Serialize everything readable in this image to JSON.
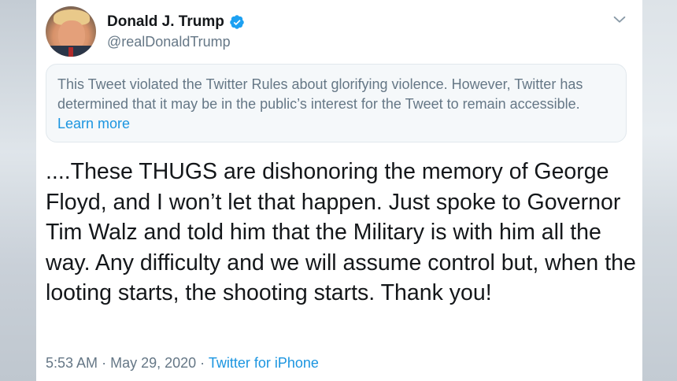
{
  "user": {
    "display_name": "Donald J. Trump",
    "handle": "@realDonaldTrump",
    "verified_icon": "verified-badge-icon"
  },
  "menu": {
    "icon": "chevron-down-icon"
  },
  "notice": {
    "text": "This Tweet violated the Twitter Rules about glorifying violence. However, Twitter has determined that it may be in the public’s interest for the Tweet to remain accessible.",
    "link_label": "Learn more"
  },
  "tweet": {
    "text": "....These THUGS are dishonoring the memory of George Floyd, and I won’t let that happen. Just spoke to Governor Tim Walz and told him that the Military is with him all the way. Any difficulty and we will assume control but, when the looting starts, the shooting starts. Thank you!"
  },
  "meta": {
    "time": "5:53 AM",
    "separator": "·",
    "date": "May 29, 2020",
    "source": "Twitter for iPhone"
  },
  "colors": {
    "link": "#1b95e0",
    "secondary_text": "#657786",
    "primary_text": "#14171a"
  }
}
